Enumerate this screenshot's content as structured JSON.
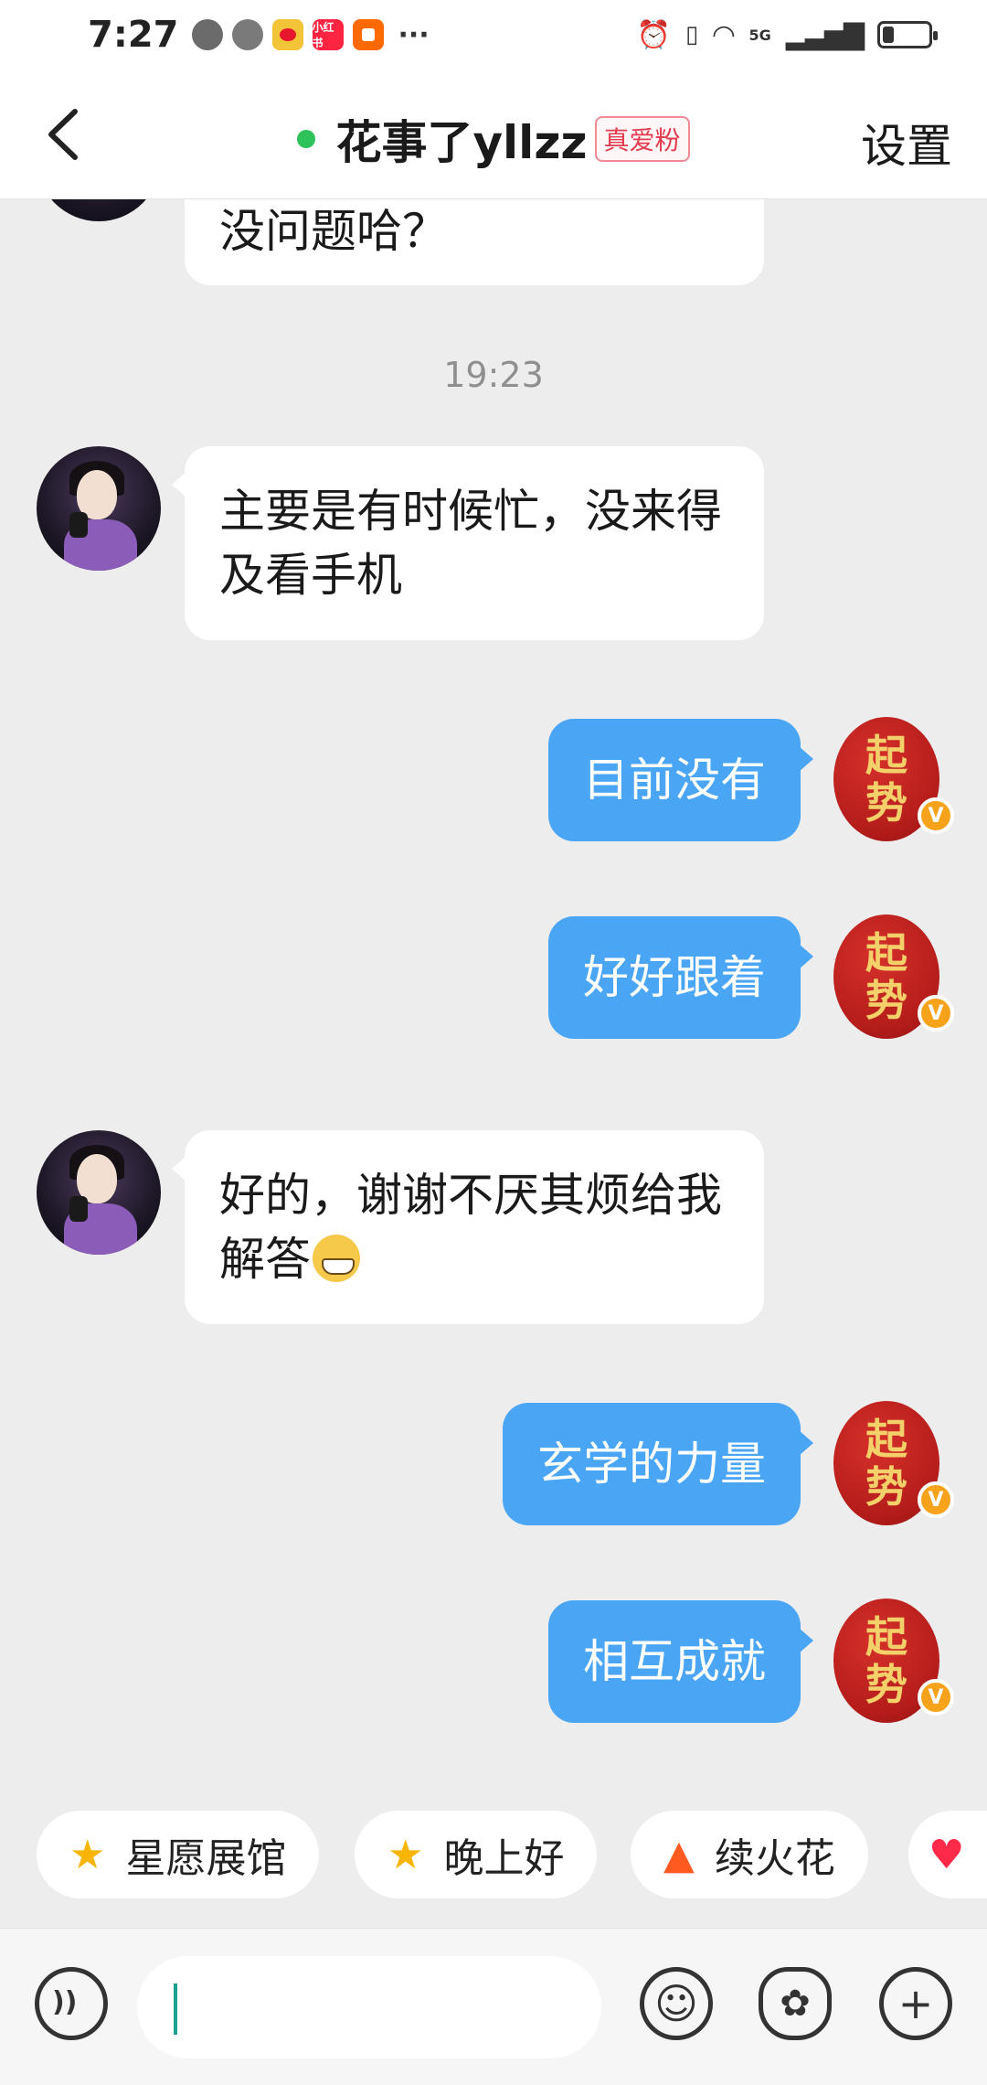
{
  "status_bar": {
    "time": "7:27",
    "apps": [
      {
        "icon": "avatar-notification-icon",
        "label": "",
        "color": "#555555"
      },
      {
        "icon": "wechat-icon",
        "label": "",
        "color": "#555555"
      },
      {
        "icon": "weibo-icon",
        "label": "",
        "color": "#e6162d"
      },
      {
        "icon": "xiaohongshu-icon",
        "label": "小红书",
        "color": "#ff2442"
      },
      {
        "icon": "taobao-icon",
        "label": "",
        "color": "#ff6a00"
      }
    ],
    "more": "···",
    "network": "5G"
  },
  "header": {
    "title": "花事了yllzz",
    "badge": "真爱粉",
    "settings_label": "设置",
    "online": true
  },
  "chat": {
    "truncated_message": "没问题哈？",
    "timestamp": "19:23",
    "messages": [
      {
        "side": "left",
        "text": "主要是有时候忙，没来得及看手机"
      },
      {
        "side": "right",
        "text": "目前没有"
      },
      {
        "side": "right",
        "text": "好好跟着"
      },
      {
        "side": "left",
        "text": "好的，谢谢不厌其烦给我解答"
      },
      {
        "side": "right",
        "text": "玄学的力量"
      },
      {
        "side": "right",
        "text": "相互成就"
      }
    ],
    "right_avatar_text": [
      "起",
      "势"
    ],
    "verified_mark": "V"
  },
  "quick_replies": [
    {
      "icon": "star-icon",
      "label": "星愿展馆"
    },
    {
      "icon": "smiling-star-icon",
      "label": "晚上好"
    },
    {
      "icon": "fire-icon",
      "label": "续火花"
    },
    {
      "icon": "heart-icon",
      "label": ""
    }
  ],
  "input_bar": {
    "value": "",
    "buttons": [
      "voice-icon",
      "emoji-icon",
      "sticker-icon",
      "plus-icon"
    ]
  },
  "colors": {
    "background": "#ededed",
    "my_bubble": "#4aa6f5",
    "their_bubble": "#ffffff",
    "online": "#2ec25a",
    "fan_badge": "#e23b4d",
    "seal_red": "#b31c1a",
    "verified": "#f6a21a"
  }
}
